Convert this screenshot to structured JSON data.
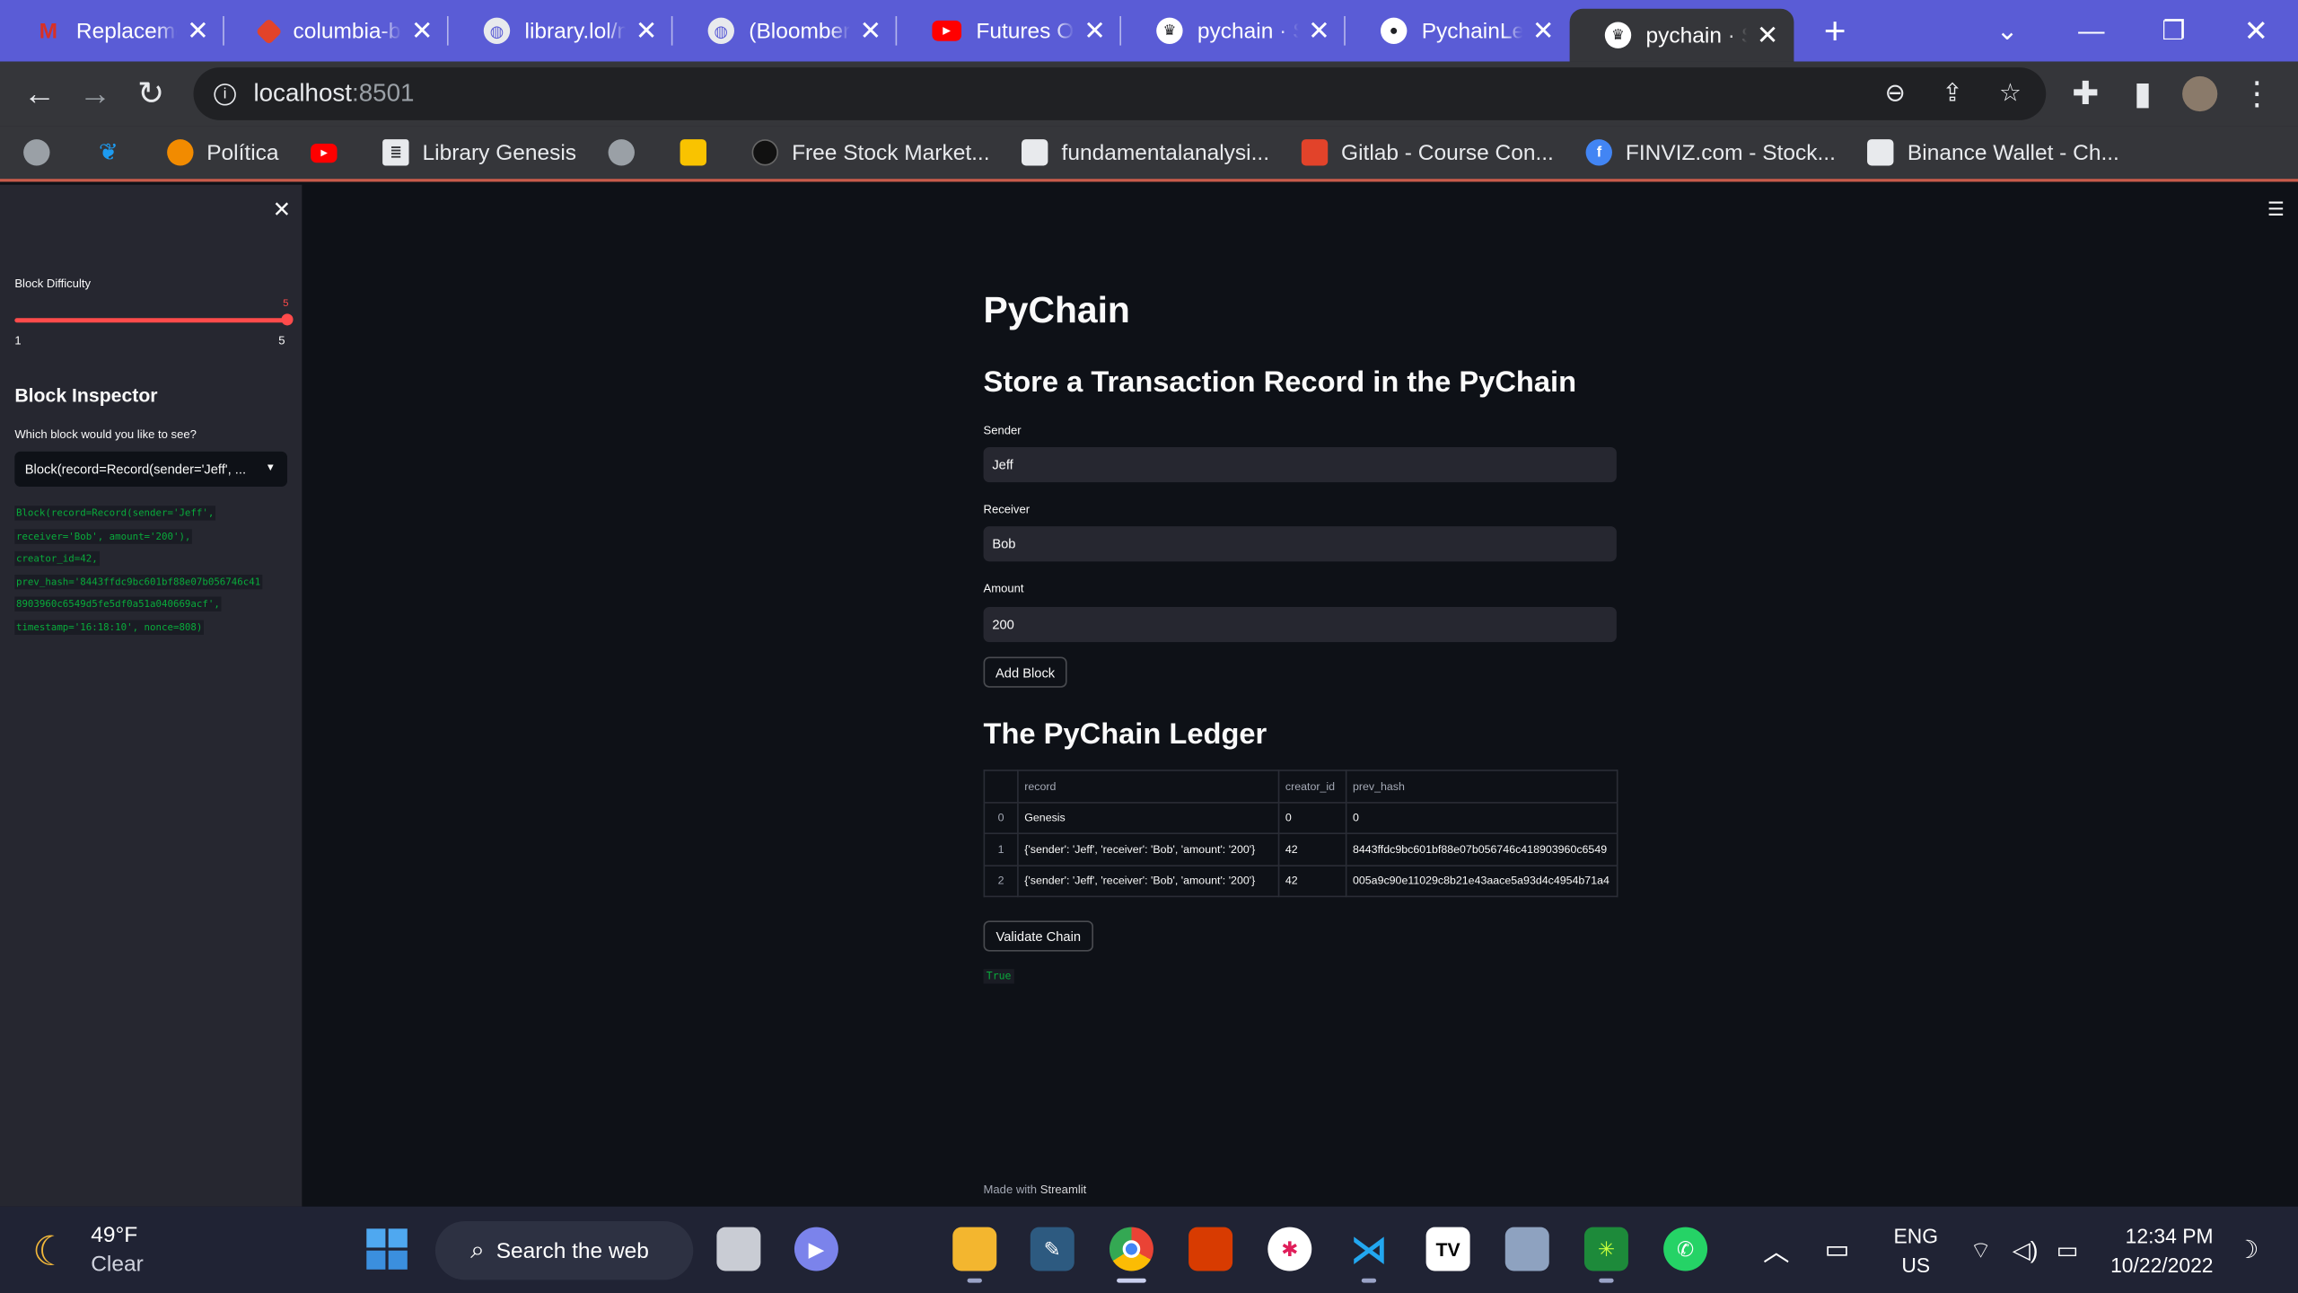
{
  "browser": {
    "tabs": [
      {
        "label": "Replacemen",
        "icon": "gmail-icon",
        "color": "#d93025"
      },
      {
        "label": "columbia-b",
        "icon": "gitlab-icon",
        "color": "#e2432a"
      },
      {
        "label": "library.lol/m",
        "icon": "globe-icon",
        "color": "#e8eaed"
      },
      {
        "label": "(Bloomberg",
        "icon": "globe-icon",
        "color": "#e8eaed"
      },
      {
        "label": "Futures Opt",
        "icon": "youtube-icon",
        "color": "#ff0000"
      },
      {
        "label": "pychain · St",
        "icon": "streamlit-crown-icon",
        "color": "#202124"
      },
      {
        "label": "PychainLed",
        "icon": "github-icon",
        "color": "#202124"
      },
      {
        "label": "pychain · St",
        "icon": "streamlit-crown-icon",
        "color": "#202124",
        "active": true
      }
    ],
    "url": "localhost",
    "port": ":8501",
    "bookmarks": [
      {
        "label": "",
        "icon": "globe-icon",
        "color": "#9aa0a6"
      },
      {
        "label": "",
        "icon": "twitter-icon",
        "color": "#1d9bf0"
      },
      {
        "label": "Política",
        "icon": "politica-icon",
        "color": "#f28b00"
      },
      {
        "label": "",
        "icon": "youtube-icon",
        "color": "#ff0000"
      },
      {
        "label": "Library Genesis",
        "icon": "library-genesis-icon",
        "color": "#e8eaed"
      },
      {
        "label": "",
        "icon": "globe-icon",
        "color": "#9aa0a6"
      },
      {
        "label": "",
        "icon": "keep-notes-icon",
        "color": "#f9c300"
      },
      {
        "label": "Free Stock Market...",
        "icon": "stock-hex-icon",
        "color": "#111111"
      },
      {
        "label": "fundamentalanalysi...",
        "icon": "cube-icon",
        "color": "#e8eaed"
      },
      {
        "label": "Gitlab - Course Con...",
        "icon": "gitlab-icon",
        "color": "#e2432a"
      },
      {
        "label": "FINVIZ.com - Stock...",
        "icon": "finviz-icon",
        "color": "#4285f4"
      },
      {
        "label": "Binance Wallet - Ch...",
        "icon": "binance-icon",
        "color": "#e8eaed"
      }
    ]
  },
  "sidebar": {
    "difficulty_label": "Block Difficulty",
    "difficulty_value": "5",
    "difficulty_min": "1",
    "difficulty_max": "5",
    "inspector_title": "Block Inspector",
    "inspector_question": "Which block would you like to see?",
    "selected_block": "Block(record=Record(sender='Jeff', ...",
    "block_code": [
      "Block(record=Record(sender='Jeff',",
      "receiver='Bob', amount='200'),",
      "creator_id=42,",
      "prev_hash='8443ffdc9bc601bf88e07b056746c41",
      "8903960c6549d5fe5df0a51a040669acf',",
      "timestamp='16:18:10', nonce=808)"
    ]
  },
  "main": {
    "title": "PyChain",
    "store_heading": "Store a Transaction Record in the PyChain",
    "sender_label": "Sender",
    "sender_value": "Jeff",
    "receiver_label": "Receiver",
    "receiver_value": "Bob",
    "amount_label": "Amount",
    "amount_value": "200",
    "add_block_label": "Add Block",
    "ledger_heading": "The PyChain Ledger",
    "columns": [
      "",
      "record",
      "creator_id",
      "prev_hash"
    ],
    "rows": [
      [
        "0",
        "Genesis",
        "0",
        "0"
      ],
      [
        "1",
        "{'sender': 'Jeff', 'receiver': 'Bob', 'amount': '200'}",
        "42",
        "8443ffdc9bc601bf88e07b056746c418903960c6549"
      ],
      [
        "2",
        "{'sender': 'Jeff', 'receiver': 'Bob', 'amount': '200'}",
        "42",
        "005a9c90e11029c8b21e43aace5a93d4c4954b71a4"
      ]
    ],
    "validate_label": "Validate Chain",
    "validate_output": "True",
    "made_with": "Made with",
    "made_with_brand": "Streamlit"
  },
  "taskbar": {
    "temperature": "49°F",
    "condition": "Clear",
    "search_placeholder": "Search the web",
    "language": "ENG",
    "region": "US",
    "time": "12:34 PM",
    "date": "10/22/2022"
  },
  "colors": {
    "accent": "#ff4b4b",
    "success": "#09ab3b",
    "tabbar": "#5a5cd6"
  }
}
